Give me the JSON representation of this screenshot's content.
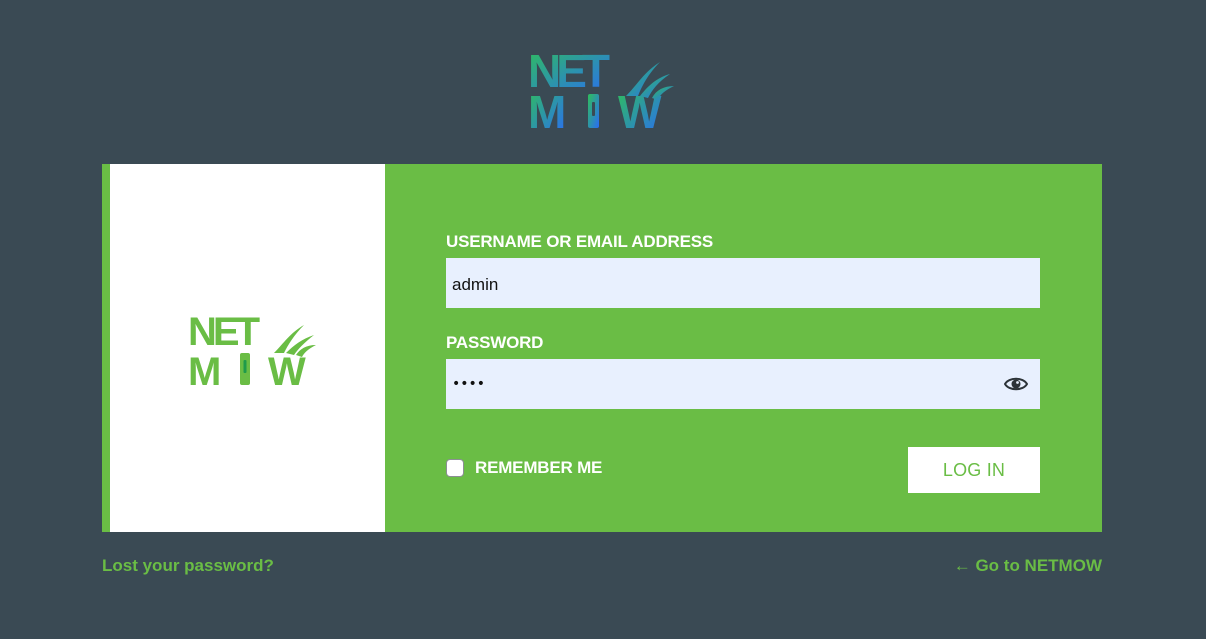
{
  "header": {
    "logo_text": "NETMOW",
    "logo_icon": "netmow-logo-gradient"
  },
  "card": {
    "logo_text": "NETMOW",
    "logo_icon": "netmow-logo-green"
  },
  "form": {
    "username_label": "USERNAME OR EMAIL ADDRESS",
    "username_value": "admin",
    "password_label": "PASSWORD",
    "password_masked": "••••",
    "password_toggle_icon": "eye-icon",
    "remember_label": "REMEMBER ME",
    "remember_checked": false,
    "login_label": "LOG IN"
  },
  "footer": {
    "lost_password": "Lost your password?",
    "back_to_site": "← Go to NETMOW"
  },
  "colors": {
    "background": "#3a4a54",
    "brand_green": "#6abd45",
    "input_fill": "#e8f0fe",
    "logo_gradient_start": "#2fbf5a",
    "logo_gradient_end": "#2a6cf5"
  }
}
